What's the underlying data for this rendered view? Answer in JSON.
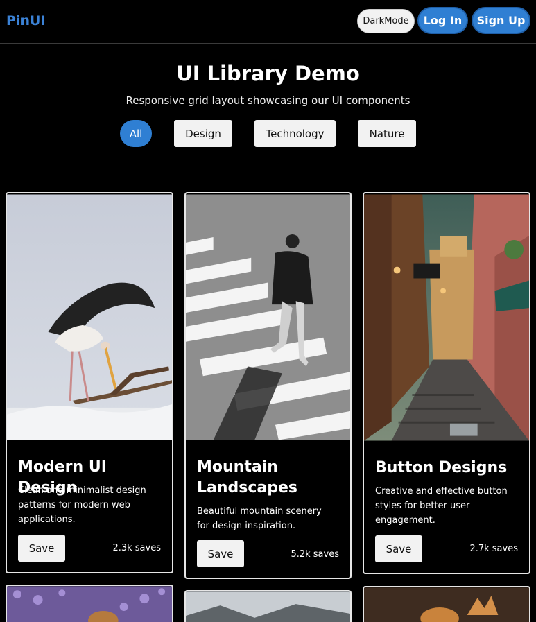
{
  "header": {
    "brand": "PinUI",
    "dark_mode_label": "DarkMode",
    "login_label": "Log In",
    "signup_label": "Sign Up"
  },
  "hero": {
    "title": "UI Library Demo",
    "subtitle": "Responsive grid layout showcasing our UI components",
    "filters": [
      "All",
      "Design",
      "Technology",
      "Nature"
    ],
    "active_filter": "All"
  },
  "cards": [
    {
      "title": "Modern UI Design",
      "description": "Clean and minimalist design patterns for modern web applications.",
      "save_label": "Save",
      "saves": "2.3k saves"
    },
    {
      "title": "Mountain Landscapes",
      "description": "Beautiful mountain scenery for design inspiration.",
      "save_label": "Save",
      "saves": "5.2k saves"
    },
    {
      "title": "Button Designs",
      "description": "Creative and effective button styles for better user engagement.",
      "save_label": "Save",
      "saves": "2.7k saves"
    }
  ],
  "colors": {
    "accent": "#2f7fd3",
    "brand": "#3b82d6",
    "background": "#000000"
  }
}
